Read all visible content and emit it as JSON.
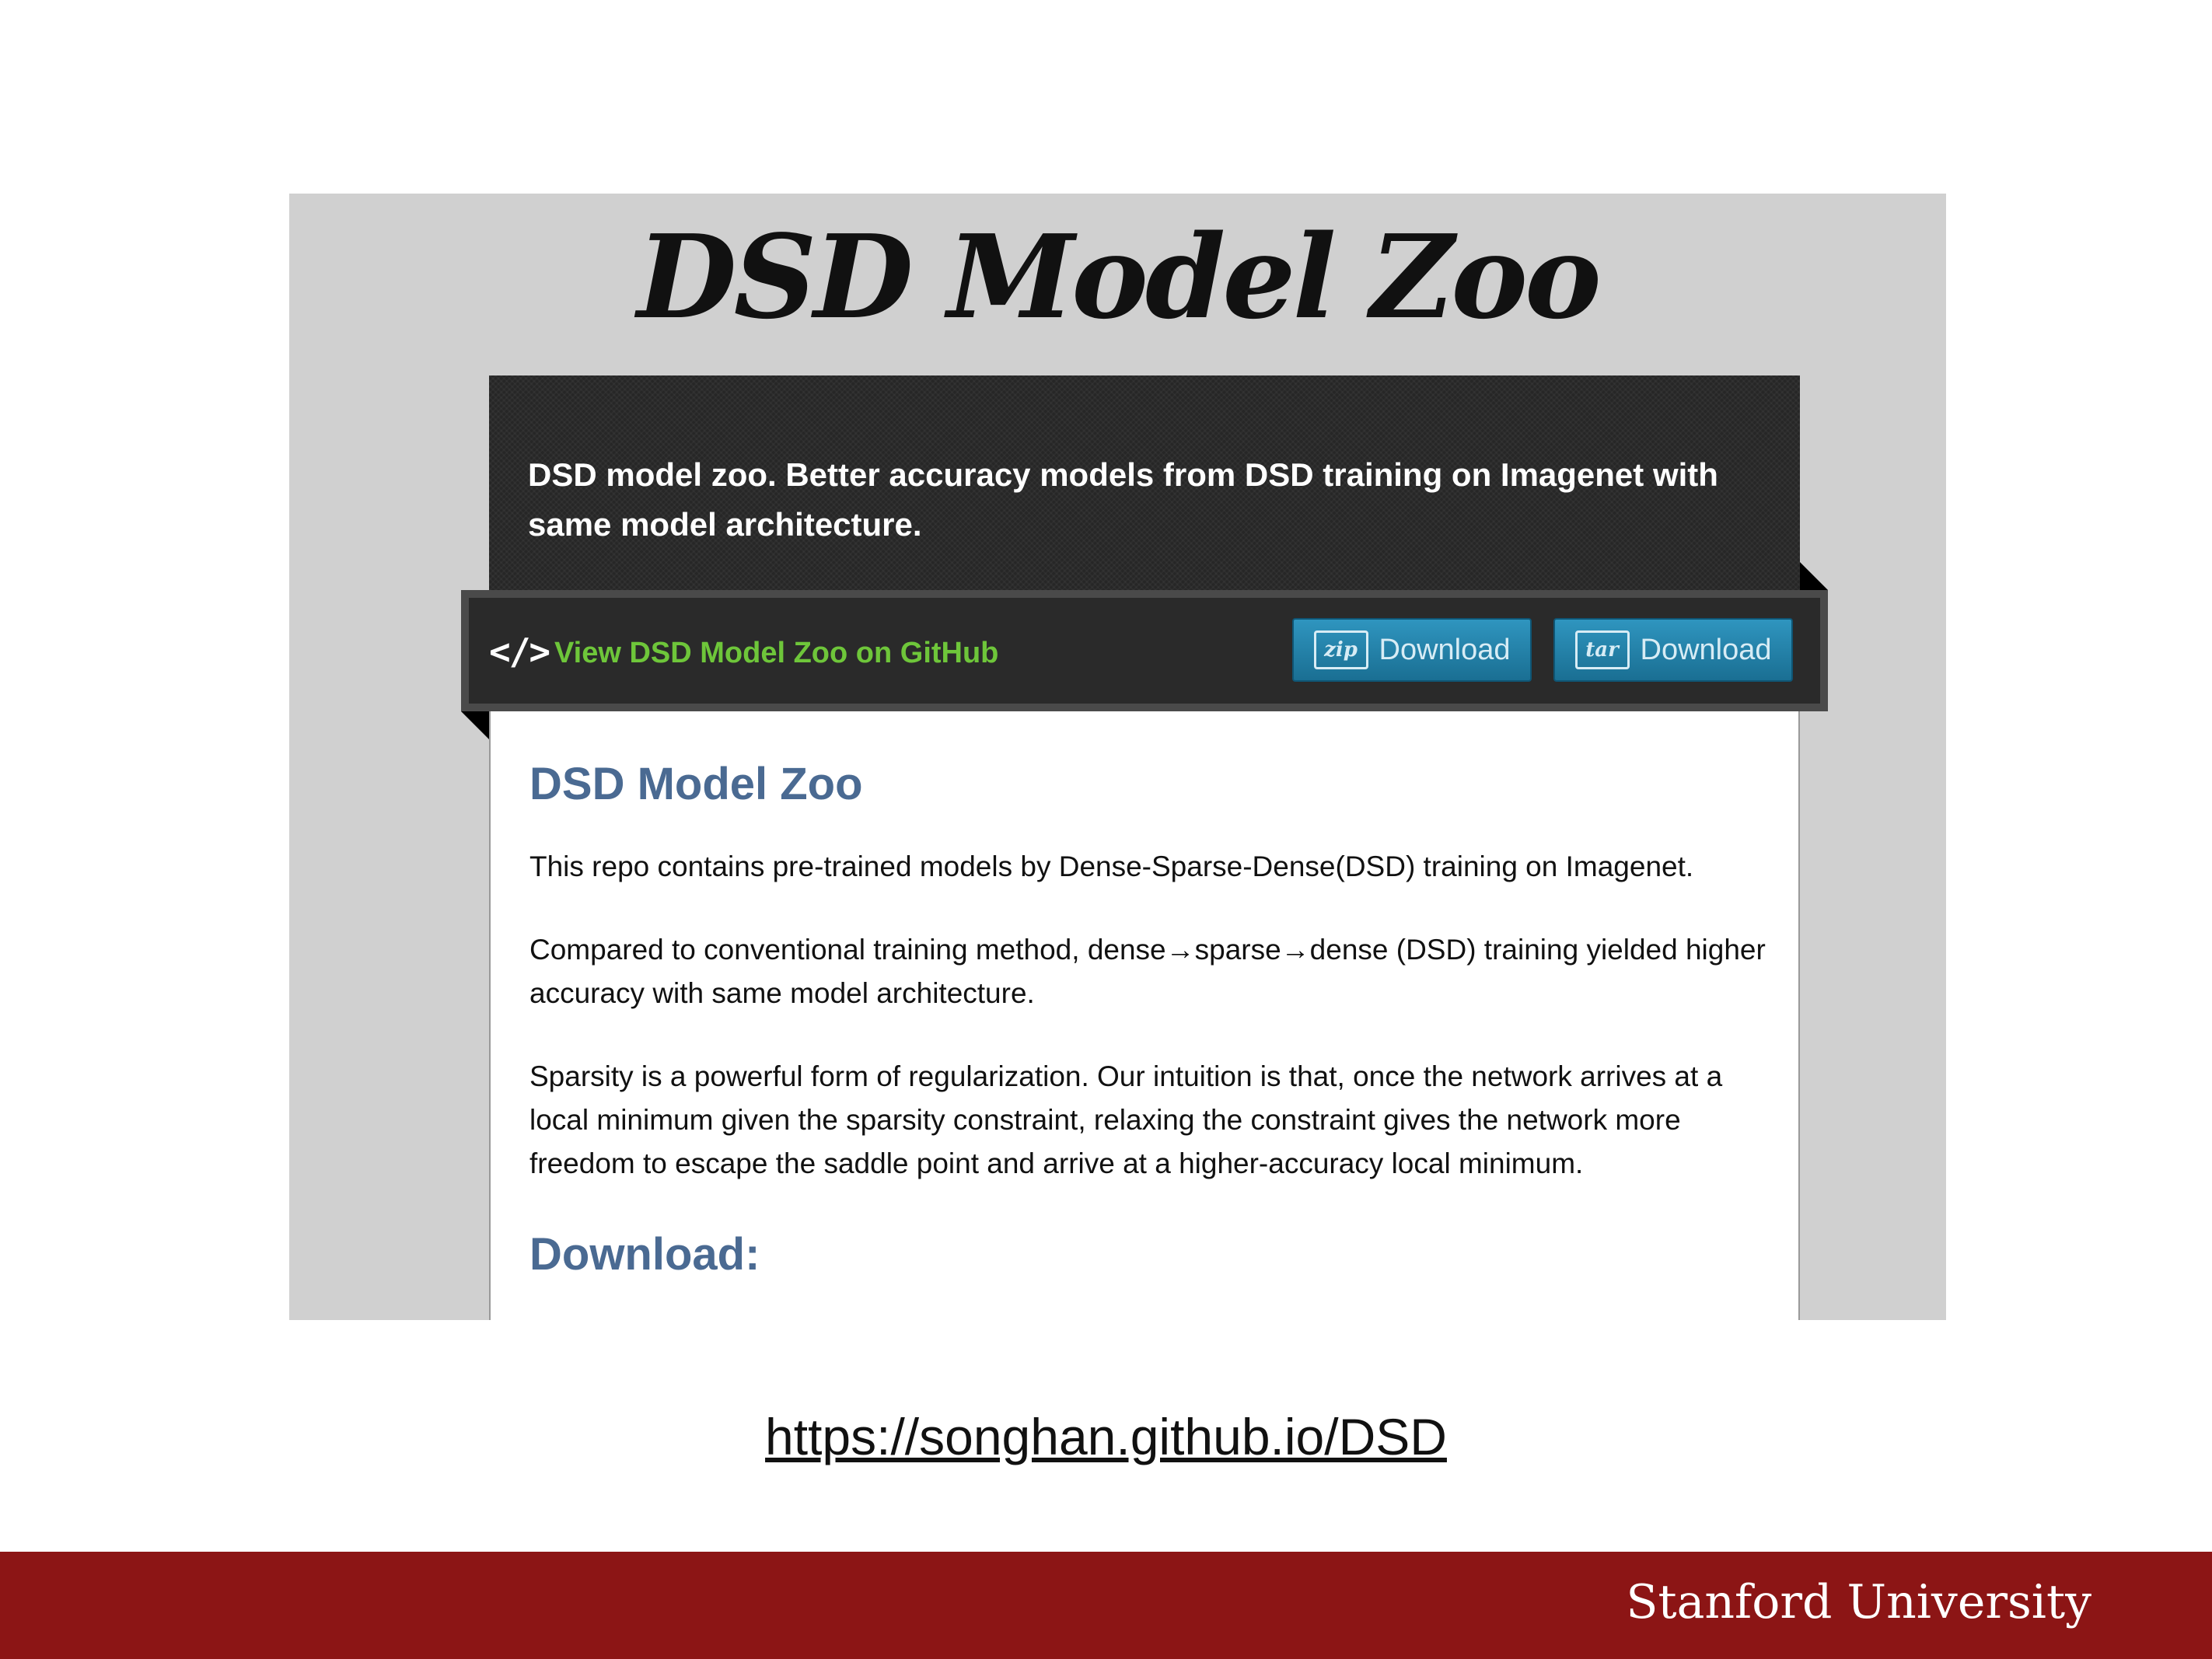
{
  "screenshot": {
    "site_title": "DSD Model Zoo",
    "header": {
      "description": "DSD model zoo. Better accuracy models from DSD training on Imagenet with same model architecture."
    },
    "toolbar": {
      "code_icon": "</>",
      "github_link": "View DSD Model Zoo on GitHub",
      "zip_icon_label": "zip",
      "zip_button": "Download",
      "tar_icon_label": "tar",
      "tar_button": "Download"
    },
    "content": {
      "heading": "DSD Model Zoo",
      "paragraphs": [
        "This repo contains pre-trained models by Dense-Sparse-Dense(DSD) training on Imagenet.",
        "Compared to conventional training method, dense→sparse→dense (DSD) training yielded higher accuracy with same model architecture.",
        "Sparsity is a powerful form of regularization. Our intuition is that, once the network arrives at a local minimum given the sparsity constraint, relaxing the constraint gives the network more freedom to escape the saddle point and arrive at a higher-accuracy local minimum."
      ],
      "download_heading": "Download:"
    }
  },
  "slide": {
    "url": "https://songhan.github.io/DSD",
    "footer_brand": "Stanford University"
  },
  "colors": {
    "footer_bg": "#8c1515",
    "link_green": "#6ec63a",
    "heading_blue": "#4a6a92",
    "button_blue": "#2486ae"
  }
}
